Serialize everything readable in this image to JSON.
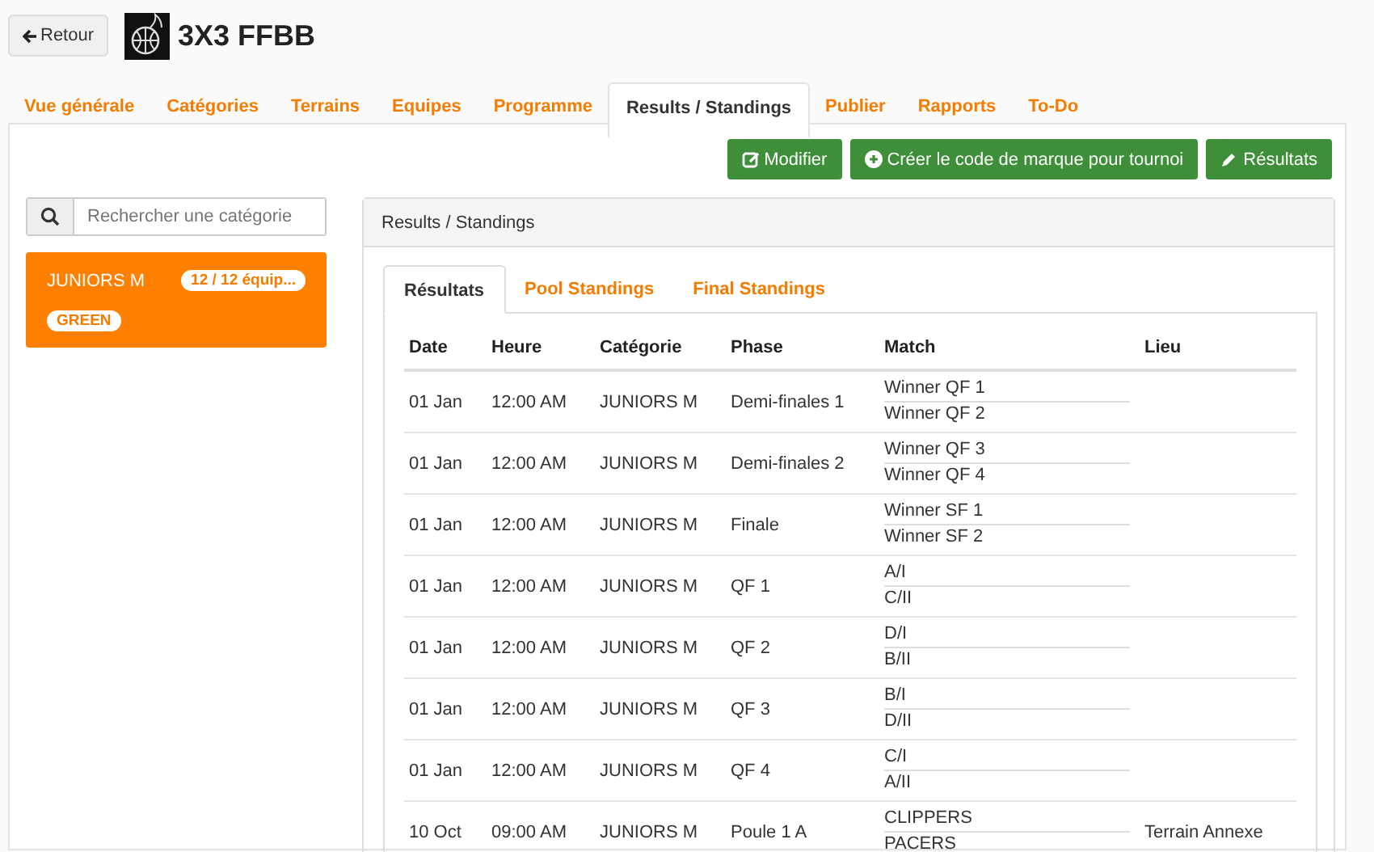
{
  "header": {
    "back_button": "Retour",
    "title": "3X3 FFBB"
  },
  "tabs": [
    {
      "label": "Vue générale",
      "selected": false
    },
    {
      "label": "Catégories",
      "selected": false
    },
    {
      "label": "Terrains",
      "selected": false
    },
    {
      "label": "Equipes",
      "selected": false
    },
    {
      "label": "Programme",
      "selected": false
    },
    {
      "label": "Results / Standings",
      "selected": true
    },
    {
      "label": "Publier",
      "selected": false
    },
    {
      "label": "Rapports",
      "selected": false
    },
    {
      "label": "To-Do",
      "selected": false
    }
  ],
  "actions": [
    {
      "kind": "edit",
      "label": "Modifier"
    },
    {
      "kind": "add",
      "label": "Créer le code de marque pour tournoi"
    },
    {
      "kind": "pencil",
      "label": "Résultats"
    }
  ],
  "sidebar": {
    "search": {
      "placeholder": "Rechercher une catégorie"
    },
    "categories": [
      {
        "name": "JUNIORS M",
        "count": "12 / 12 équip...",
        "tag": "GREEN",
        "selected": true
      }
    ]
  },
  "panel": {
    "title": "Results / Standings",
    "tabs": [
      {
        "label": "Résultats",
        "selected": true
      },
      {
        "label": "Pool Standings",
        "selected": false
      },
      {
        "label": "Final Standings",
        "selected": false
      }
    ],
    "table": {
      "columns": [
        "Date",
        "Heure",
        "Catégorie",
        "Phase",
        "Match",
        "Lieu"
      ],
      "rows": [
        {
          "date": "01 Jan",
          "time": "12:00 AM",
          "category": "JUNIORS M",
          "phase": "Demi-finales 1",
          "team_1": "Winner QF 1",
          "team_2": "Winner QF 2"
        },
        {
          "date": "01 Jan",
          "time": "12:00 AM",
          "category": "JUNIORS M",
          "phase": "Demi-finales 2",
          "team_1": "Winner QF 3",
          "team_2": "Winner QF 4"
        },
        {
          "date": "01 Jan",
          "time": "12:00 AM",
          "category": "JUNIORS M",
          "phase": "Finale",
          "team_1": "Winner SF 1",
          "team_2": "Winner SF 2"
        },
        {
          "date": "01 Jan",
          "time": "12:00 AM",
          "category": "JUNIORS M",
          "phase": "QF 1",
          "team_1": "A/I",
          "team_2": "C/II"
        },
        {
          "date": "01 Jan",
          "time": "12:00 AM",
          "category": "JUNIORS M",
          "phase": "QF 2",
          "team_1": "D/I",
          "team_2": "B/II"
        },
        {
          "date": "01 Jan",
          "time": "12:00 AM",
          "category": "JUNIORS M",
          "phase": "QF 3",
          "team_1": "B/I",
          "team_2": "D/II"
        },
        {
          "date": "01 Jan",
          "time": "12:00 AM",
          "category": "JUNIORS M",
          "phase": "QF 4",
          "team_1": "C/I",
          "team_2": "A/II"
        },
        {
          "date": "10 Oct",
          "time": "09:00 AM",
          "category": "JUNIORS M",
          "phase": "Poule 1 A",
          "team_1": "CLIPPERS",
          "team_2": "PACERS",
          "venue": "Terrain Annexe"
        }
      ]
    }
  }
}
